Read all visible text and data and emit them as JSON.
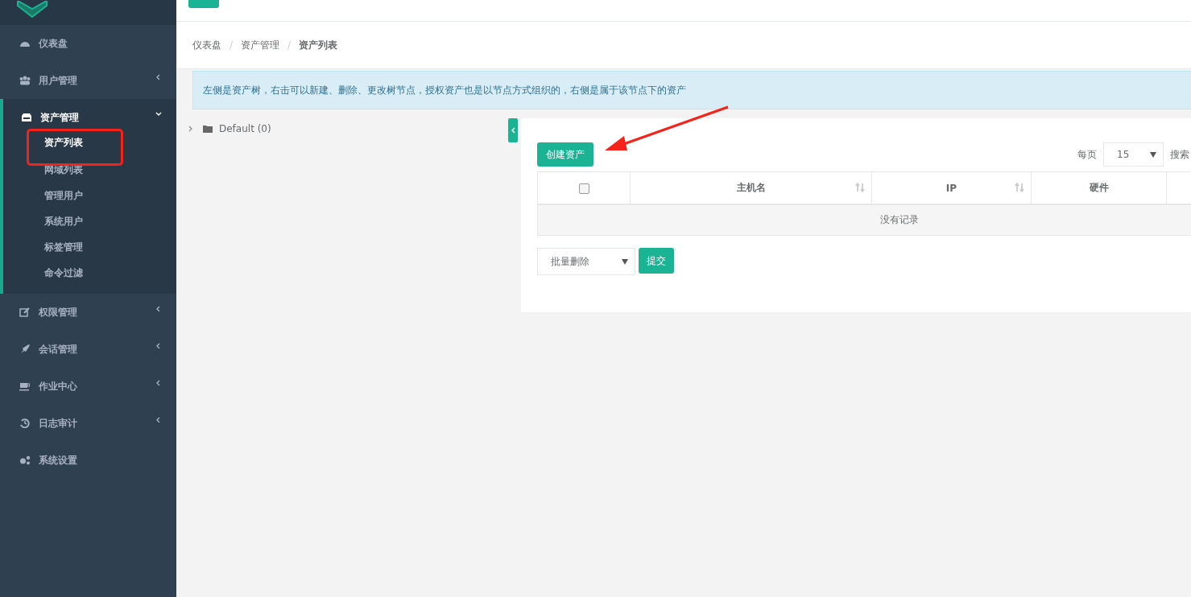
{
  "sidebar": {
    "items": [
      {
        "label": "仪表盘",
        "kind": "link"
      },
      {
        "label": "用户管理",
        "kind": "menu",
        "expanded": false
      },
      {
        "label": "资产管理",
        "kind": "menu",
        "expanded": true,
        "children": [
          {
            "label": "资产列表",
            "selected": true
          },
          {
            "label": "网域列表",
            "selected": false
          },
          {
            "label": "管理用户",
            "selected": false
          },
          {
            "label": "系统用户",
            "selected": false
          },
          {
            "label": "标签管理",
            "selected": false
          },
          {
            "label": "命令过滤",
            "selected": false
          }
        ]
      },
      {
        "label": "权限管理",
        "kind": "menu",
        "expanded": false
      },
      {
        "label": "会话管理",
        "kind": "menu",
        "expanded": false
      },
      {
        "label": "作业中心",
        "kind": "menu",
        "expanded": false
      },
      {
        "label": "日志审计",
        "kind": "menu",
        "expanded": false
      },
      {
        "label": "系统设置",
        "kind": "link"
      }
    ]
  },
  "breadcrumb": {
    "separator": "/",
    "items": [
      "仪表盘",
      "资产管理",
      "资产列表"
    ]
  },
  "alert": "左侧是资产树，右击可以新建、删除、更改树节点，授权资产也是以节点方式组织的，右侧是属于该节点下的资产",
  "tree": [
    {
      "label": "Default (0)",
      "expanded": false
    }
  ],
  "toolbar": {
    "create_button": "创建资产",
    "page_size_label": "每页",
    "page_size": "15",
    "search_label": "搜索"
  },
  "table": {
    "columns": [
      {
        "kind": "checkbox",
        "checked": false
      },
      {
        "kind": "text",
        "label": "主机名",
        "sortable": true
      },
      {
        "kind": "text",
        "label": "IP",
        "sortable": true
      },
      {
        "kind": "text",
        "label": "硬件",
        "sortable": false
      },
      {
        "kind": "blank"
      }
    ],
    "empty_text": "没有记录"
  },
  "bulk": {
    "action": "批量删除",
    "submit": "提交"
  }
}
